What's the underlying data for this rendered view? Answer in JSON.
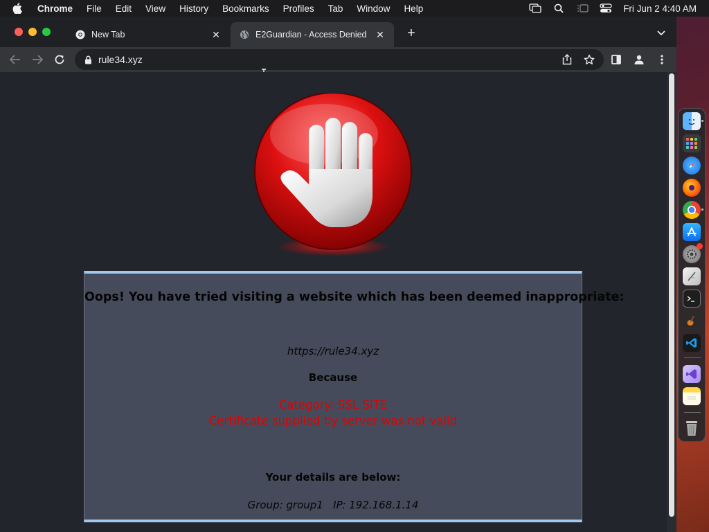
{
  "menubar": {
    "app_name": "Chrome",
    "items": [
      "File",
      "Edit",
      "View",
      "History",
      "Bookmarks",
      "Profiles",
      "Tab",
      "Window",
      "Help"
    ],
    "clock": "Fri Jun 2  4:40 AM"
  },
  "tabs": [
    {
      "title": "New Tab",
      "active": false,
      "favicon": "chrome-icon"
    },
    {
      "title": "E2Guardian - Access Denied",
      "active": true,
      "favicon": "globe-icon"
    }
  ],
  "toolbar": {
    "url": "rule34.xyz"
  },
  "page": {
    "headline": "Oops! You have tried visiting a website which has been deemed inappropriate:",
    "blocked_url": "https://rule34.xyz",
    "because": "Because",
    "category_line": "Category: SSL SITE",
    "reason_line": "Certificate supplied by server was not valid",
    "details_heading": "Your details are below:",
    "user_info": "Group: group1   IP: 192.168.1.14"
  },
  "colors": {
    "page_background": "#22252c",
    "panel_background": "#464b5b",
    "panel_border": "#9fc9ee",
    "reason_text": "#e00000"
  },
  "dock": {
    "apps": [
      "finder-icon",
      "launchpad-icon",
      "safari-icon",
      "firefox-icon",
      "chrome-icon",
      "app-store-icon",
      "system-settings-icon",
      "script-editor-icon",
      "terminal-icon",
      "garageband-icon",
      "vscode-icon",
      "visual-studio-icon",
      "notes-icon",
      "trash-icon"
    ]
  }
}
